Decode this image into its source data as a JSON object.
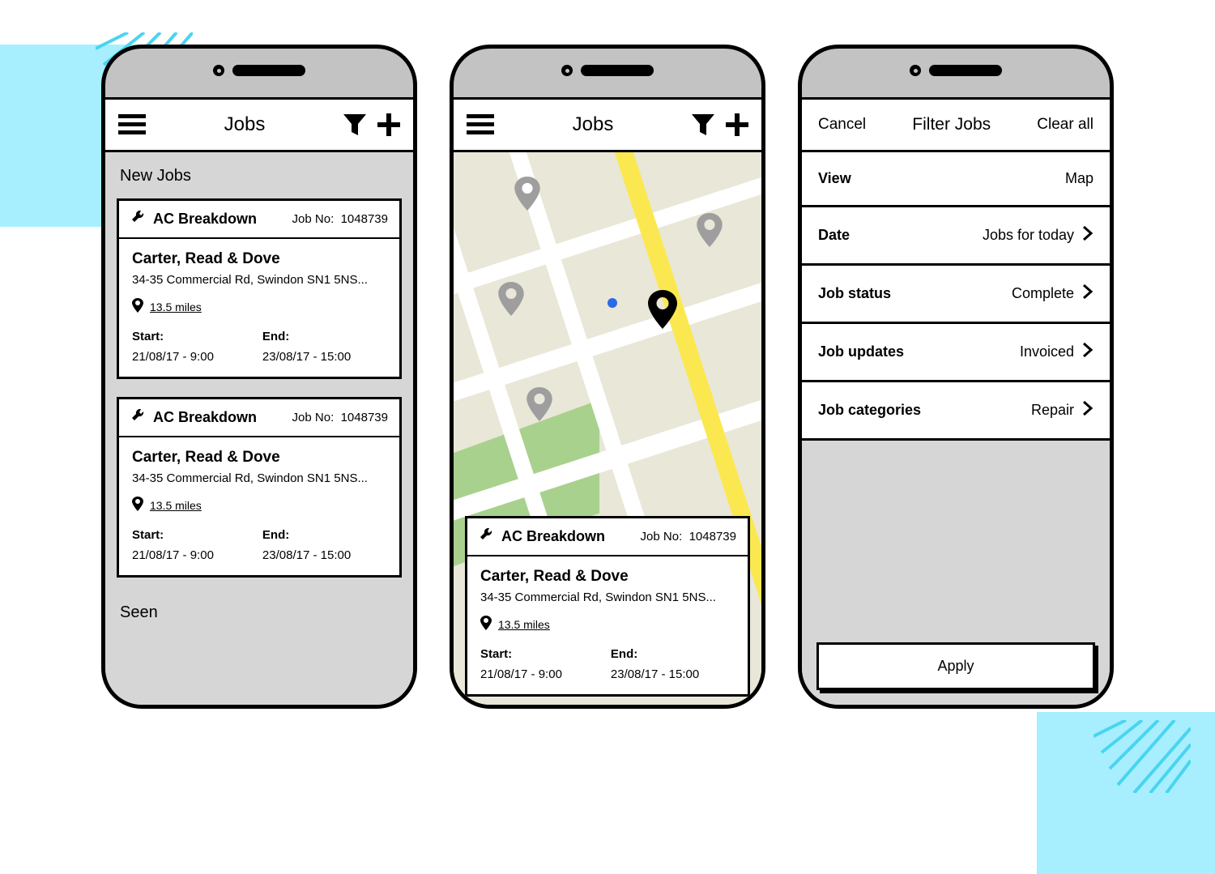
{
  "screen1": {
    "title": "Jobs",
    "section_new": "New Jobs",
    "section_seen": "Seen",
    "cards": [
      {
        "type": "AC Breakdown",
        "jobno_label": "Job No:",
        "jobno": "1048739",
        "customer": "Carter, Read & Dove",
        "address": "34-35 Commercial Rd, Swindon SN1 5NS...",
        "distance": "13.5 miles",
        "start_label": "Start:",
        "start": "21/08/17 - 9:00",
        "end_label": "End:",
        "end": "23/08/17 - 15:00"
      },
      {
        "type": "AC Breakdown",
        "jobno_label": "Job No:",
        "jobno": "1048739",
        "customer": "Carter, Read & Dove",
        "address": "34-35 Commercial Rd, Swindon SN1 5NS...",
        "distance": "13.5 miles",
        "start_label": "Start:",
        "start": "21/08/17 - 9:00",
        "end_label": "End:",
        "end": "23/08/17 - 15:00"
      }
    ]
  },
  "screen2": {
    "title": "Jobs",
    "card": {
      "type": "AC Breakdown",
      "jobno_label": "Job No:",
      "jobno": "1048739",
      "customer": "Carter, Read & Dove",
      "address": "34-35 Commercial Rd, Swindon SN1 5NS...",
      "distance": "13.5 miles",
      "start_label": "Start:",
      "start": "21/08/17 - 9:00",
      "end_label": "End:",
      "end": "23/08/17 - 15:00"
    }
  },
  "screen3": {
    "cancel": "Cancel",
    "title": "Filter Jobs",
    "clear": "Clear all",
    "rows": [
      {
        "label": "View",
        "value": "Map",
        "chevron": false
      },
      {
        "label": "Date",
        "value": "Jobs for today",
        "chevron": true
      },
      {
        "label": "Job status",
        "value": "Complete",
        "chevron": true
      },
      {
        "label": "Job updates",
        "value": "Invoiced",
        "chevron": true
      },
      {
        "label": "Job categories",
        "value": "Repair",
        "chevron": true
      }
    ],
    "apply": "Apply"
  }
}
